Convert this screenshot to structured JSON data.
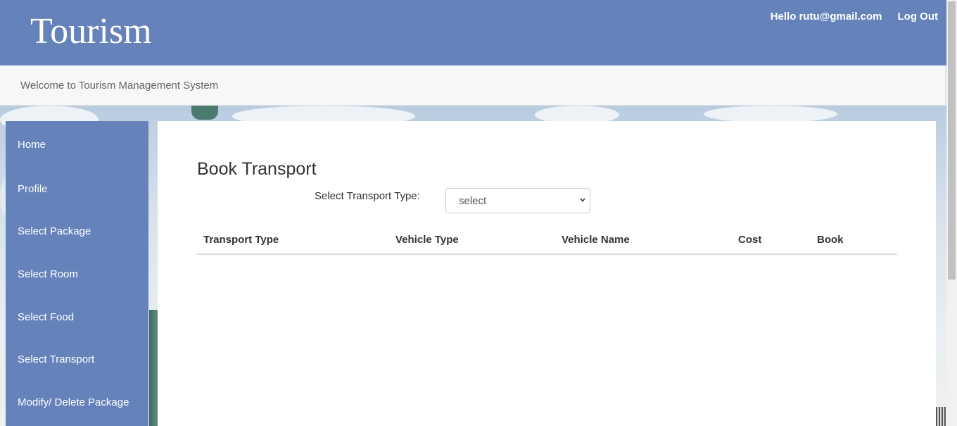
{
  "header": {
    "brand": "Tourism",
    "greeting": "Hello rutu@gmail.com",
    "logout": "Log Out",
    "accent": "#6582bb"
  },
  "welcome": "Welcome to Tourism Management System",
  "sidebar": {
    "items": [
      {
        "label": "Home"
      },
      {
        "label": "Profile"
      },
      {
        "label": "Select Package"
      },
      {
        "label": "Select Room"
      },
      {
        "label": "Select Food"
      },
      {
        "label": "Select Transport"
      },
      {
        "label": "Modify/ Delete Package"
      }
    ]
  },
  "main": {
    "title": "Book Transport",
    "filter_label": "Select Transport Type:",
    "filter_value": "select",
    "table": {
      "columns": [
        "Transport Type",
        "Vehicle Type",
        "Vehicle Name",
        "Cost",
        "Book"
      ],
      "rows": []
    }
  }
}
